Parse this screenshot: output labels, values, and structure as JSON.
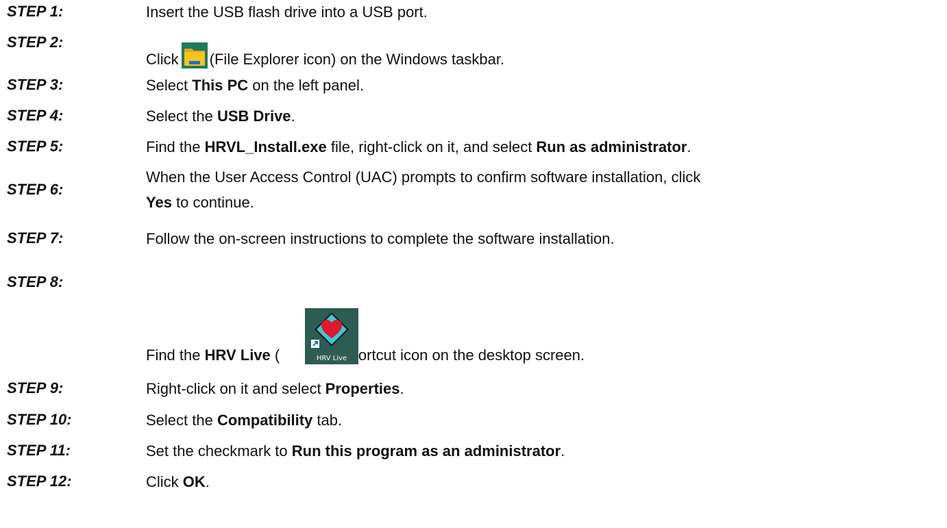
{
  "steps": [
    {
      "label": "STEP 1:",
      "parts": [
        {
          "t": "Insert the USB flash drive into a USB port."
        }
      ]
    },
    {
      "label": "STEP 2:",
      "parts": [
        {
          "t": "Click"
        },
        {
          "t": "(File Explorer icon) on the Windows taskbar."
        }
      ]
    },
    {
      "label": "STEP 3:",
      "parts": [
        {
          "t": "Select "
        },
        {
          "b": "This PC"
        },
        {
          "t": " on the left panel."
        }
      ]
    },
    {
      "label": "STEP 4:",
      "parts": [
        {
          "t": "Select the "
        },
        {
          "b": "USB Drive"
        },
        {
          "t": "."
        }
      ]
    },
    {
      "label": "STEP 5:",
      "parts": [
        {
          "t": "Find the "
        },
        {
          "b": "HRVL_Install.exe"
        },
        {
          "t": " file, right-click on it, and select "
        },
        {
          "b": "Run as administrator"
        },
        {
          "t": "."
        }
      ]
    },
    {
      "label": "STEP 6:",
      "line1": "When the User Access Control (UAC) prompts to confirm software installation, click",
      "line2_bold": "Yes",
      "line2_text": " to continue."
    },
    {
      "label": "STEP 7:",
      "parts": [
        {
          "t": "Follow the on-screen instructions to complete the software installation."
        }
      ]
    },
    {
      "label": "STEP 8:",
      "parts": [
        {
          "t": "Find the "
        },
        {
          "b": "HRV Live"
        },
        {
          "t": " ("
        },
        {
          "t": ") shortcut icon on the desktop screen."
        }
      ]
    },
    {
      "label": "STEP 9:",
      "parts": [
        {
          "t": "Right-click on it and select "
        },
        {
          "b": "Properties"
        },
        {
          "t": "."
        }
      ]
    },
    {
      "label": "STEP 10:",
      "parts": [
        {
          "t": "Select the "
        },
        {
          "b": "Compatibility"
        },
        {
          "t": " tab."
        }
      ]
    },
    {
      "label": "STEP 11:",
      "parts": [
        {
          "t": "Set the checkmark to "
        },
        {
          "b": "Run this program as an administrator"
        },
        {
          "t": "."
        }
      ]
    },
    {
      "label": "STEP 12:",
      "parts": [
        {
          "t": "Click "
        },
        {
          "b": "OK"
        },
        {
          "t": "."
        }
      ]
    }
  ],
  "icons": {
    "file_explorer": "file-explorer-icon",
    "hrv_live": "hrv-live-shortcut-icon",
    "hrv_live_caption": "HRV Live"
  },
  "colors": {
    "text": "#111111",
    "folder_yellow": "#f5c518",
    "folder_blue": "#1f6fd1",
    "desktop_green": "#2d5d52",
    "heart_red": "#e0182d",
    "diamond_cyan": "#3ec7d9"
  }
}
